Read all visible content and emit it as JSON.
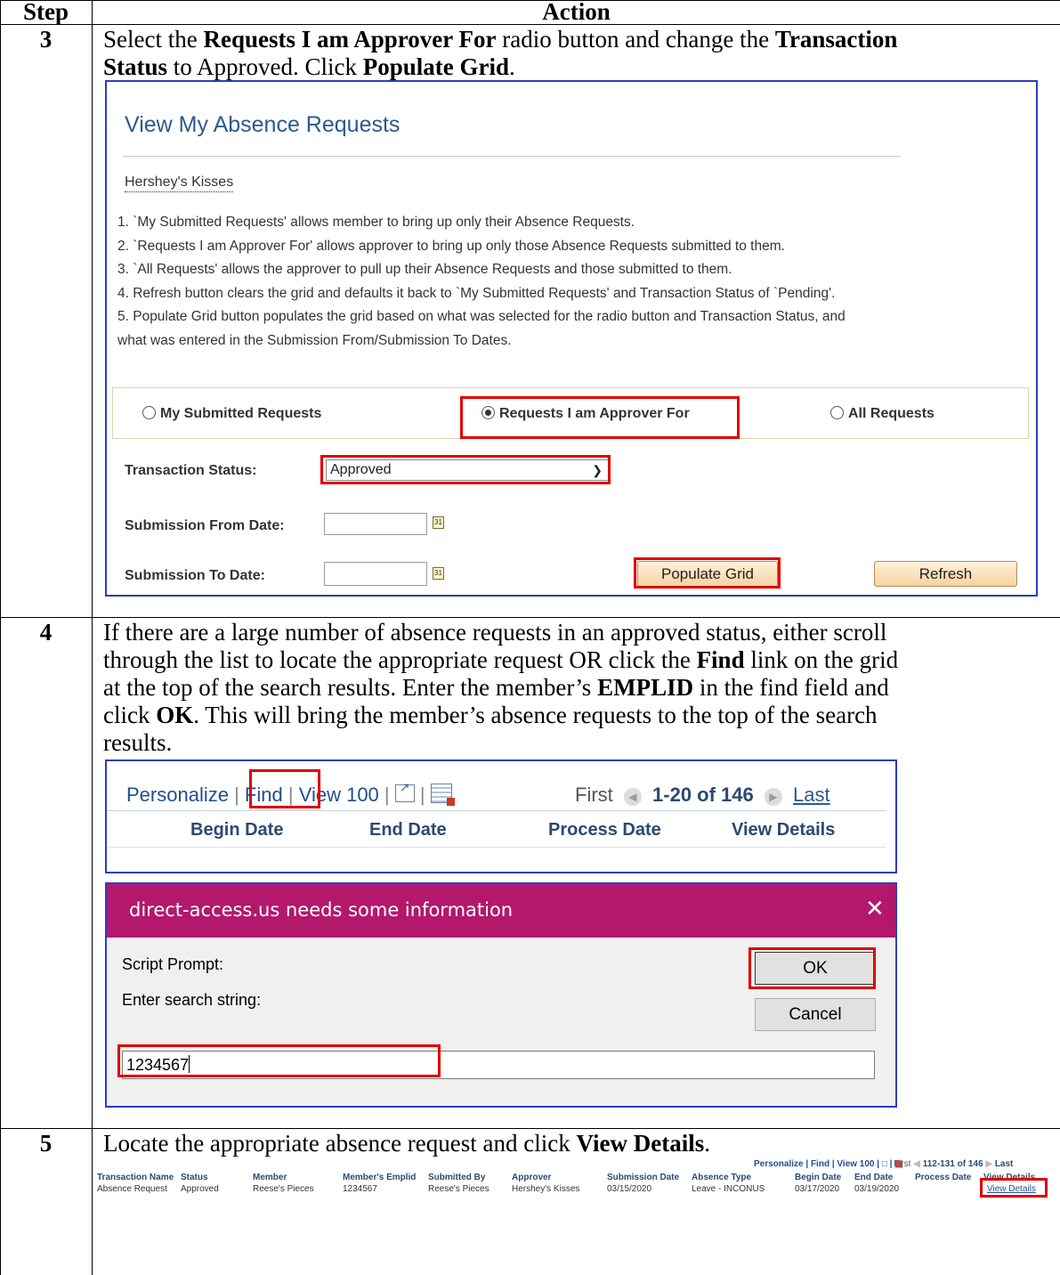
{
  "table": {
    "header_step": "Step",
    "header_action": "Action"
  },
  "step3": {
    "number": "3",
    "text_a": "Select the ",
    "bold_a": "Requests I am Approver For",
    "text_b": " radio button and change the ",
    "bold_b1": "Transaction",
    "bold_b2": "Status",
    "text_c": " to Approved.  Click ",
    "bold_c": "Populate Grid",
    "text_d": ".",
    "screen": {
      "title": "View My Absence Requests",
      "user_name": "Hershey's Kisses",
      "notes": [
        "1. `My Submitted Requests' allows member to bring up only their Absence Requests.",
        "2. `Requests I am Approver For' allows approver to bring up only those Absence Requests submitted to them.",
        "3. `All Requests' allows the approver to pull up their Absence Requests and those submitted to them.",
        "4. Refresh button clears the grid and defaults it back to `My Submitted Requests' and Transaction Status of `Pending'.",
        "5. Populate Grid button populates the grid based on what was selected for the radio button and Transaction Status, and",
        "what was entered in the Submission From/Submission To Dates."
      ],
      "radio_my": "My Submitted Requests",
      "radio_approver": "Requests I am Approver For",
      "radio_all": "All Requests",
      "transaction_status_label": "Transaction Status:",
      "transaction_status_value": "Approved",
      "from_date_label": "Submission From Date:",
      "to_date_label": "Submission To Date:",
      "populate_button": "Populate Grid",
      "refresh_button": "Refresh",
      "calendar_icon_text": "31"
    }
  },
  "step4": {
    "number": "4",
    "lines": [
      "If there are a large number of absence requests in an approved status, either scroll",
      "through the list to locate the appropriate request OR click the ",
      "at the top of the search results.  Enter the member’s ",
      "click ",
      "results."
    ],
    "find_bold": "Find",
    "line2_end": " link on the grid",
    "emplid_bold": "EMPLID",
    "line3_end": " in the find field and",
    "ok_bold": "OK",
    "line4_end": ".  This will bring the member’s absence requests to the top of the search",
    "grid": {
      "personalize": "Personalize",
      "find": "Find",
      "view100": "View 100",
      "first": "First",
      "range": "1-20 of 146",
      "last": "Last",
      "columns": [
        "Begin Date",
        "End Date",
        "Process Date",
        "View Details"
      ]
    },
    "dialog": {
      "title": "direct-access.us needs some information",
      "script_prompt": "Script Prompt:",
      "enter_search": "Enter search string:",
      "ok": "OK",
      "cancel": "Cancel",
      "input_value": "1234567"
    }
  },
  "step5": {
    "number": "5",
    "text_a": "Locate the appropriate absence request and click ",
    "bold_a": "View Details",
    "text_b": ".",
    "grid_toolbar": {
      "personalize": "Personalize",
      "find": "Find",
      "view100": "View 100",
      "first": "First",
      "range": "112-131 of 146",
      "last": "Last"
    },
    "columns": [
      "Transaction Name",
      "Status",
      "Member",
      "Member's Emplid",
      "Submitted By",
      "Approver",
      "Submission Date",
      "Absence Type",
      "Begin Date",
      "End Date",
      "Process Date",
      "View Details"
    ],
    "row": [
      "Absence Request",
      "Approved",
      "Reese's Pieces",
      "1234567",
      "Reese's Pieces",
      "Hershey's Kisses",
      "03/15/2020",
      "Leave - INCONUS",
      "03/17/2020",
      "03/19/2020",
      "",
      "View Details"
    ]
  }
}
